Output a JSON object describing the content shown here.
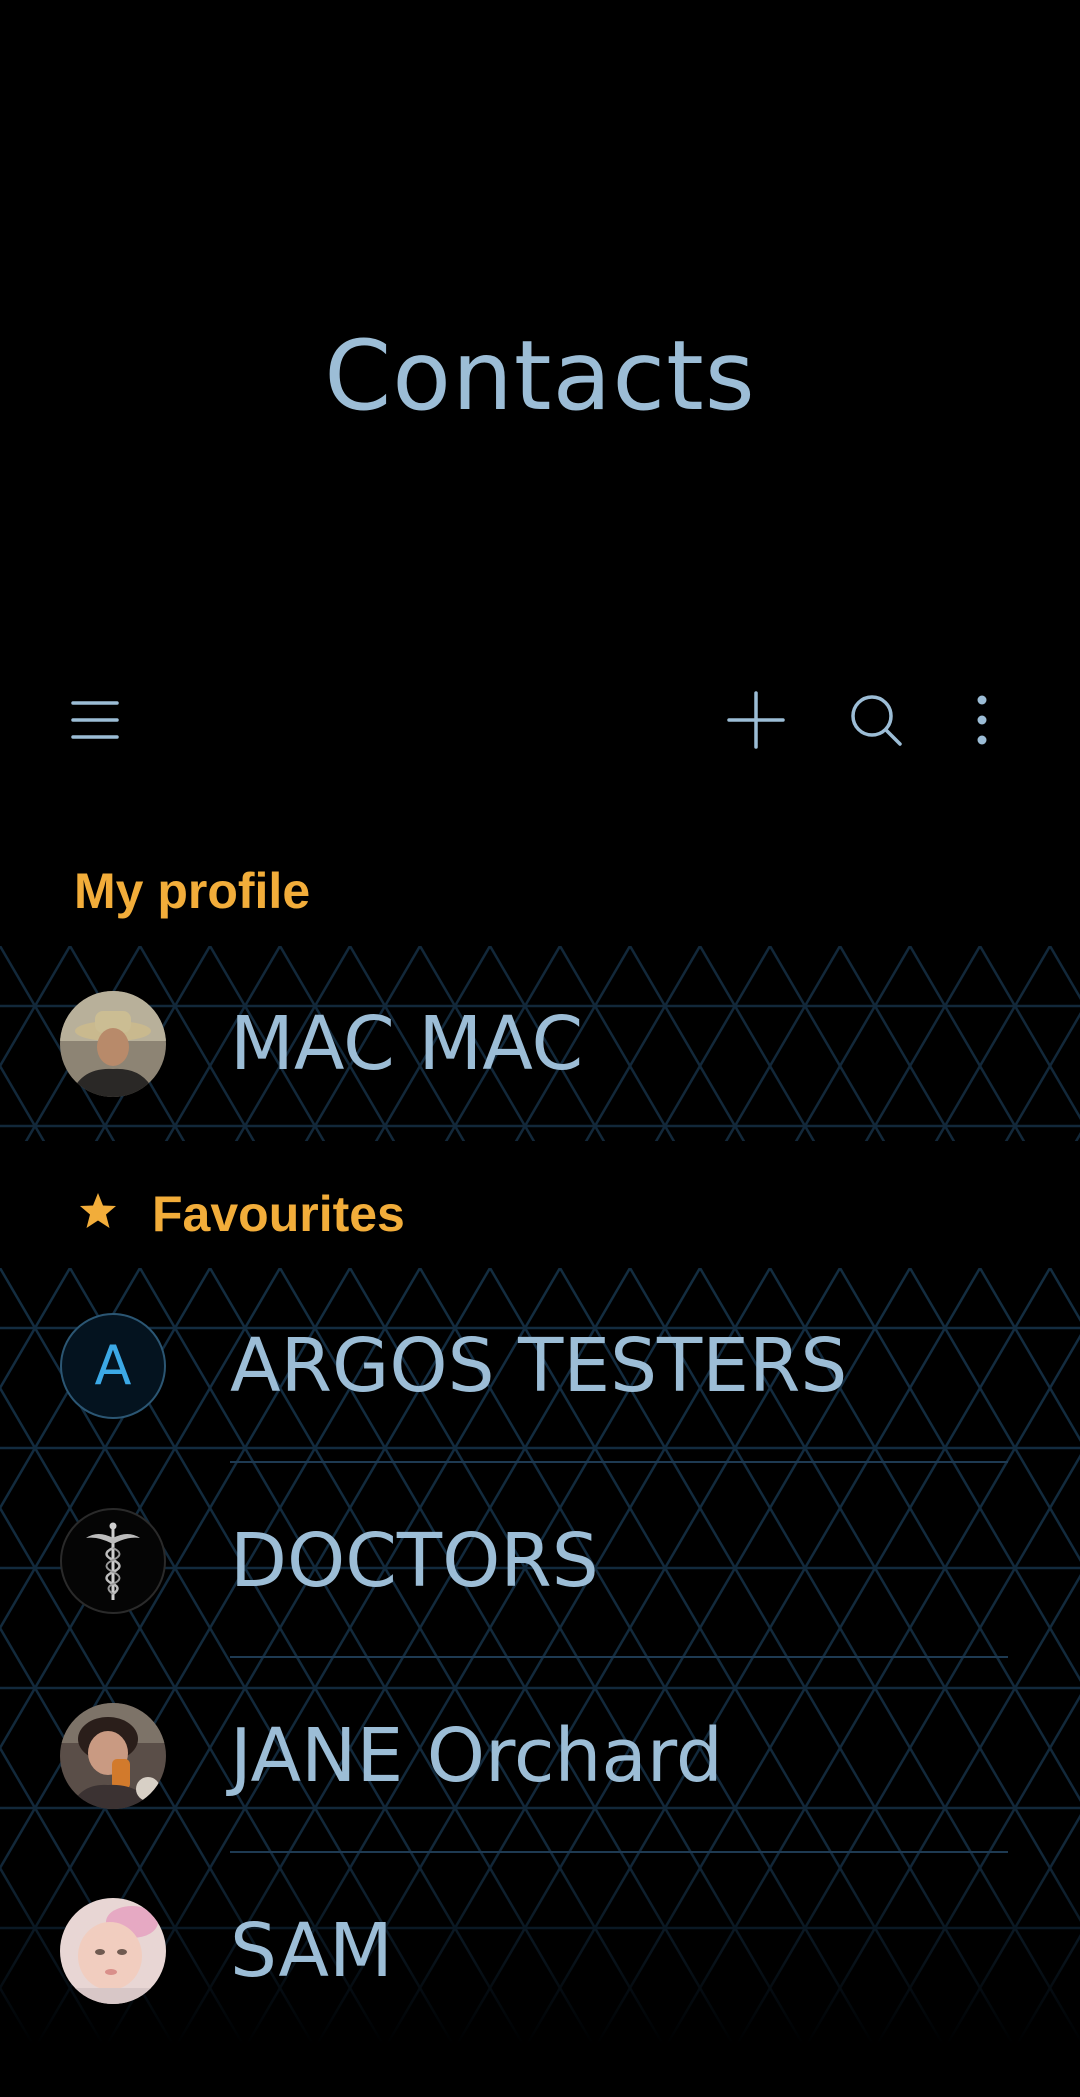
{
  "header": {
    "title": "Contacts"
  },
  "toolbar": {
    "menu_icon": "hamburger-menu-icon",
    "add_icon": "plus-icon",
    "search_icon": "search-icon",
    "more_icon": "more-vert-icon"
  },
  "sections": {
    "my_profile": {
      "label": "My profile",
      "contact": {
        "name": "MAC MAC",
        "avatar": "photo"
      }
    },
    "favourites": {
      "label": "Favourites",
      "icon": "star-icon",
      "contacts": [
        {
          "name": "ARGOS TESTERS",
          "avatar": "letter",
          "letter": "A"
        },
        {
          "name": "DOCTORS",
          "avatar": "caduceus-icon"
        },
        {
          "name": "JANE Orchard",
          "avatar": "photo"
        },
        {
          "name": "SAM",
          "avatar": "photo"
        }
      ]
    }
  },
  "colors": {
    "background": "#000000",
    "title": "#9cbdd6",
    "section_header": "#f2ad3a",
    "contact_name": "#9cbdd6",
    "letter_avatar": "#3ca9e6",
    "pattern_line": "#163248"
  }
}
